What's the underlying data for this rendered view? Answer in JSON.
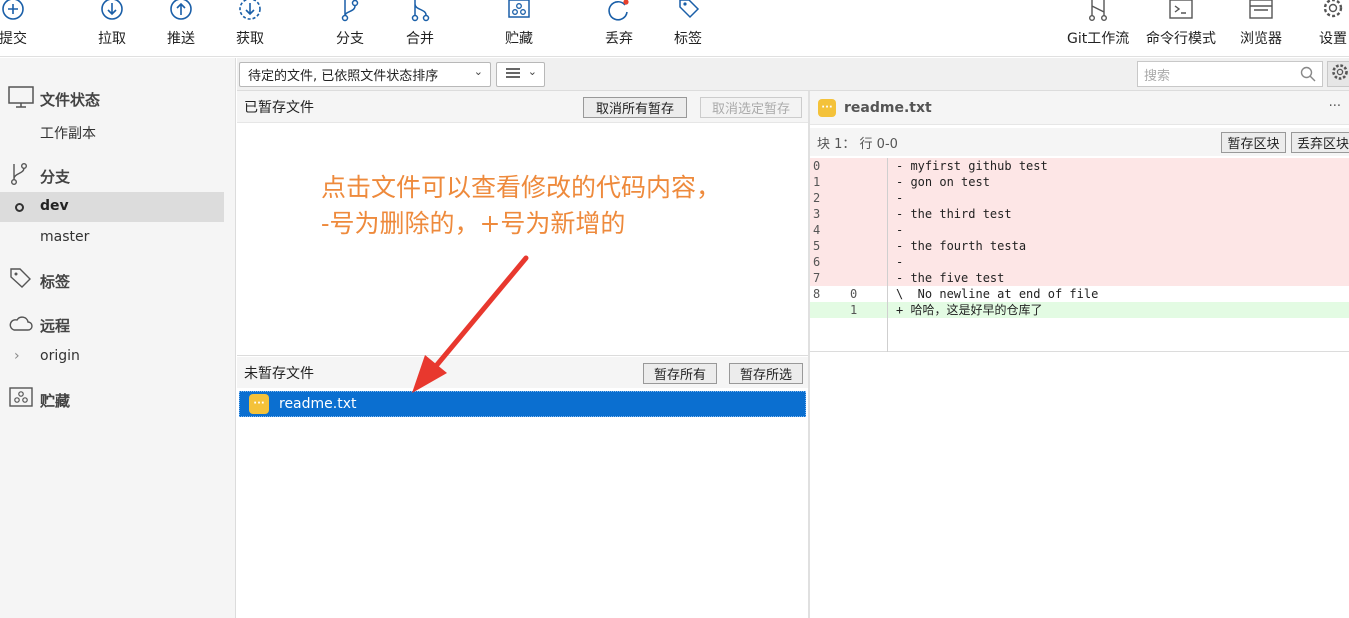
{
  "toolbar": {
    "items": [
      {
        "label": "提交",
        "icon": "plus-circle-icon"
      },
      {
        "label": "拉取",
        "icon": "arrow-down-circle-icon"
      },
      {
        "label": "推送",
        "icon": "arrow-up-circle-icon"
      },
      {
        "label": "获取",
        "icon": "dashed-arrow-down-circle-icon"
      },
      {
        "label": "分支",
        "icon": "branch-icon"
      },
      {
        "label": "合并",
        "icon": "merge-icon"
      },
      {
        "label": "贮藏",
        "icon": "stash-icon"
      },
      {
        "label": "丢弃",
        "icon": "discard-icon"
      },
      {
        "label": "标签",
        "icon": "tag-icon"
      },
      {
        "label": "Git工作流",
        "icon": "gitflow-icon"
      },
      {
        "label": "命令行模式",
        "icon": "terminal-icon"
      },
      {
        "label": "浏览器",
        "icon": "browser-icon"
      },
      {
        "label": "设置",
        "icon": "gear-icon"
      }
    ]
  },
  "sidebar": {
    "file_status": {
      "title": "文件状态",
      "items": [
        "工作副本"
      ]
    },
    "branches": {
      "title": "分支",
      "items": [
        "dev",
        "master"
      ],
      "active": "dev"
    },
    "tags": {
      "title": "标签"
    },
    "remotes": {
      "title": "远程",
      "items": [
        "origin"
      ]
    },
    "stashes": {
      "title": "贮藏"
    }
  },
  "filter": {
    "sort_select": "待定的文件, 已依照文件状态排序",
    "view_select_icon": "list-icon",
    "search_placeholder": "搜索"
  },
  "staged": {
    "title": "已暂存文件",
    "unstage_all": "取消所有暂存",
    "unstage_selected": "取消选定暂存"
  },
  "unstaged": {
    "title": "未暂存文件",
    "stage_all": "暂存所有",
    "stage_selected": "暂存所选",
    "files": [
      {
        "name": "readme.txt",
        "status": "modified"
      }
    ]
  },
  "diff": {
    "filename": "readme.txt",
    "more": "···",
    "hunk_title": "块 1：  行 0-0",
    "stage_hunk": "暂存区块",
    "discard_hunk": "丢弃区块",
    "lines": [
      {
        "type": "del",
        "old": "0",
        "new": "",
        "text": "- myfirst github test"
      },
      {
        "type": "del",
        "old": "1",
        "new": "",
        "text": "- gon on test"
      },
      {
        "type": "del",
        "old": "2",
        "new": "",
        "text": "-"
      },
      {
        "type": "del",
        "old": "3",
        "new": "",
        "text": "- the third test"
      },
      {
        "type": "del",
        "old": "4",
        "new": "",
        "text": "-"
      },
      {
        "type": "del",
        "old": "5",
        "new": "",
        "text": "- the fourth testa"
      },
      {
        "type": "del",
        "old": "6",
        "new": "",
        "text": "-"
      },
      {
        "type": "del",
        "old": "7",
        "new": "",
        "text": "- the five test"
      },
      {
        "type": "ctx",
        "old": "8",
        "new": "0",
        "text": "\\  No newline at end of file"
      },
      {
        "type": "add",
        "old": "",
        "new": "1",
        "text": "+ 哈哈，这是好早的仓库了"
      }
    ]
  },
  "annotation": {
    "line1": "点击文件可以查看修改的代码内容，",
    "line2": "-号为删除的，+号为新增的",
    "color": "#ee8a3c"
  },
  "colors": {
    "accent": "#0b6fd0",
    "icon_blue": "#1a5fa8",
    "deleted_bg": "#fde6e6",
    "added_bg": "#e3fbe3",
    "file_modified": "#f4c23a"
  }
}
